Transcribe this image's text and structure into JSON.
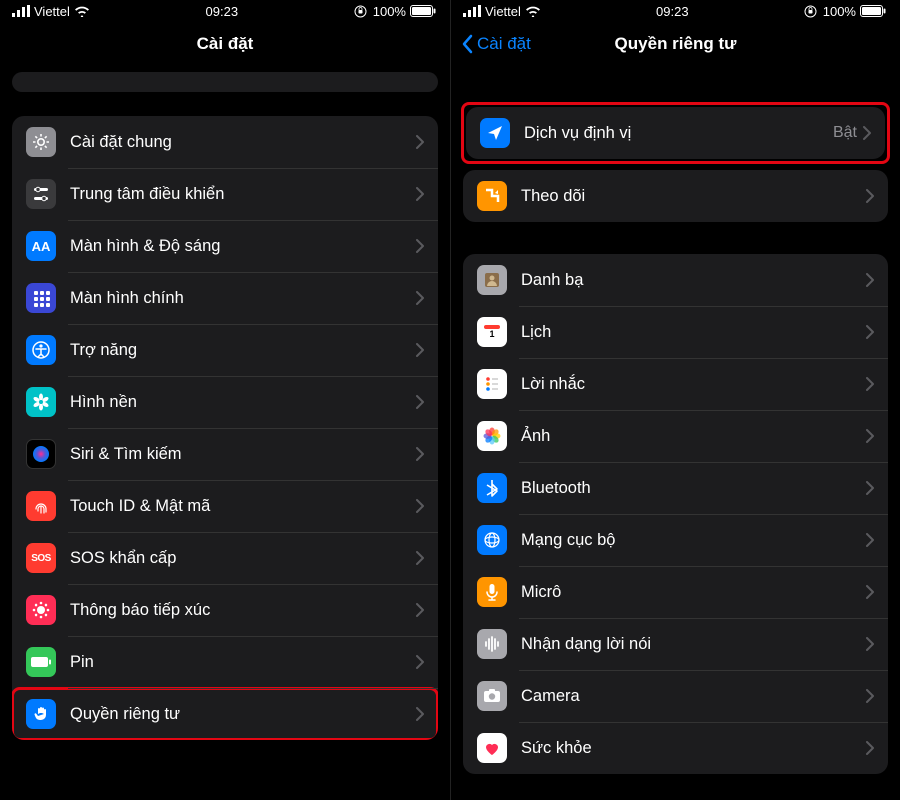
{
  "status": {
    "carrier": "Viettel",
    "time": "09:23",
    "battery": "100%"
  },
  "left": {
    "title": "Cài đặt",
    "rows": [
      {
        "icon": "gear",
        "bg": "bg-gray",
        "label": "Cài đặt chung"
      },
      {
        "icon": "sliders",
        "bg": "bg-darkgray",
        "label": "Trung tâm điều khiển"
      },
      {
        "icon": "aa",
        "bg": "bg-blue",
        "label": "Màn hình & Độ sáng"
      },
      {
        "icon": "grid",
        "bg": "bg-home",
        "label": "Màn hình chính"
      },
      {
        "icon": "access",
        "bg": "bg-blue",
        "label": "Trợ năng"
      },
      {
        "icon": "flower",
        "bg": "bg-teal",
        "label": "Hình nền"
      },
      {
        "icon": "siri",
        "bg": "bg-black",
        "label": "Siri & Tìm kiếm"
      },
      {
        "icon": "touchid",
        "bg": "bg-red",
        "label": "Touch ID & Mật mã"
      },
      {
        "icon": "sos",
        "bg": "bg-sos",
        "label": "SOS khẩn cấp"
      },
      {
        "icon": "covid",
        "bg": "bg-pink",
        "label": "Thông báo tiếp xúc"
      },
      {
        "icon": "battery",
        "bg": "bg-green",
        "label": "Pin"
      },
      {
        "icon": "hand",
        "bg": "bg-blue",
        "label": "Quyền riêng tư",
        "highlight": true
      }
    ]
  },
  "right": {
    "back": "Cài đặt",
    "title": "Quyền riêng tư",
    "group1": [
      {
        "icon": "location",
        "bg": "bg-blue",
        "label": "Dịch vụ định vị",
        "value": "Bật",
        "highlight": true
      },
      {
        "icon": "tracking",
        "bg": "bg-orange",
        "label": "Theo dõi"
      }
    ],
    "group2": [
      {
        "icon": "contacts",
        "bg": "bg-ltgray",
        "label": "Danh bạ"
      },
      {
        "icon": "calendar",
        "bg": "bg-white",
        "label": "Lịch"
      },
      {
        "icon": "reminders",
        "bg": "bg-white",
        "label": "Lời nhắc"
      },
      {
        "icon": "photos",
        "bg": "bg-photos",
        "label": "Ảnh"
      },
      {
        "icon": "bluetooth",
        "bg": "bg-blue",
        "label": "Bluetooth"
      },
      {
        "icon": "network",
        "bg": "bg-blue",
        "label": "Mạng cục bộ"
      },
      {
        "icon": "mic",
        "bg": "bg-orange",
        "label": "Micrô"
      },
      {
        "icon": "speech",
        "bg": "bg-ltgray",
        "label": "Nhận dạng lời nói"
      },
      {
        "icon": "camera",
        "bg": "bg-ltgray",
        "label": "Camera"
      },
      {
        "icon": "health",
        "bg": "bg-white",
        "label": "Sức khỏe"
      }
    ]
  }
}
